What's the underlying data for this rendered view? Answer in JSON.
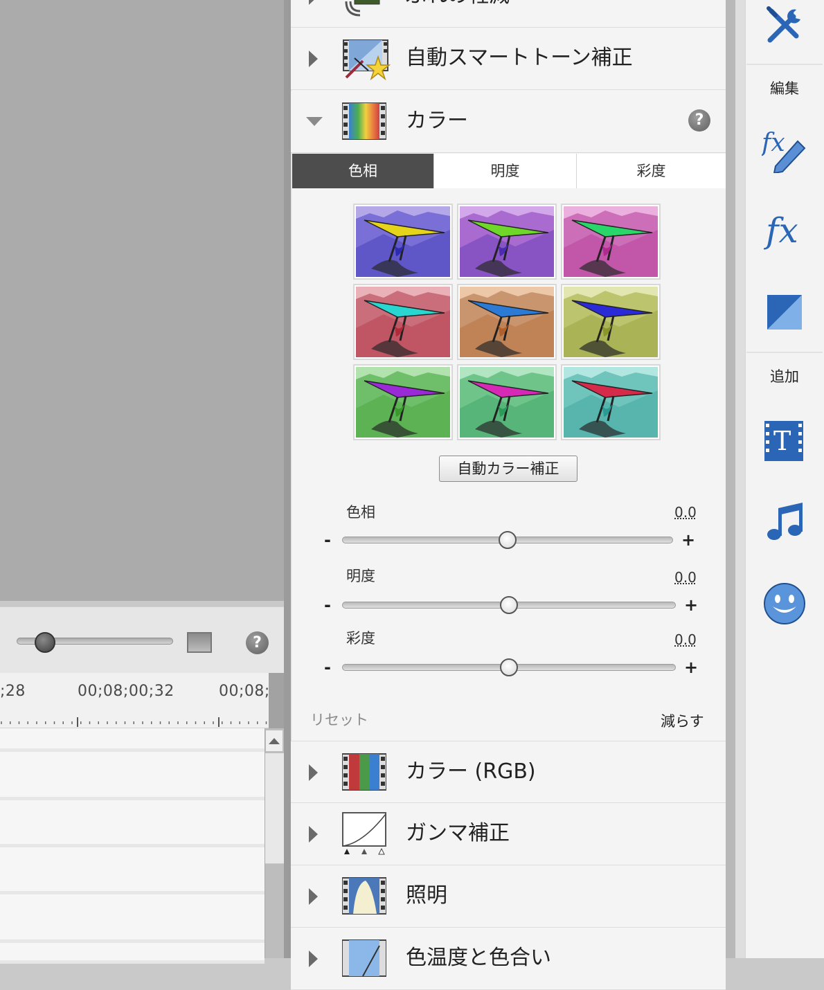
{
  "timeline": {
    "timecodes": [
      ";28",
      "00;08;00;32",
      "00;08;"
    ]
  },
  "effects_list": {
    "items_above": [
      {
        "label": "ぶれの軽減"
      },
      {
        "label": "自動スマートトーン補正"
      }
    ],
    "expanded": {
      "label": "カラー",
      "tabs": [
        "色相",
        "明度",
        "彩度"
      ],
      "active_tab": "色相",
      "auto_button": "自動カラー補正",
      "sliders": [
        {
          "label": "色相",
          "value": "0.0",
          "minus": "-",
          "plus": "+",
          "position": 0.5
        },
        {
          "label": "明度",
          "value": "0.0",
          "minus": "-",
          "plus": "+",
          "position": 0.5
        },
        {
          "label": "彩度",
          "value": "0.0",
          "minus": "-",
          "plus": "+",
          "position": 0.5
        }
      ],
      "reset_label": "リセット",
      "reduce_label": "減らす"
    },
    "items_below": [
      {
        "label": "カラー (RGB)"
      },
      {
        "label": "ガンマ補正"
      },
      {
        "label": "照明"
      },
      {
        "label": "色温度と色合い"
      }
    ]
  },
  "toolbar": {
    "edit_label": "編集",
    "add_label": "追加"
  },
  "colors": {
    "active_tab": "#4d4d4d",
    "tool_blue": "#2b66b6"
  }
}
